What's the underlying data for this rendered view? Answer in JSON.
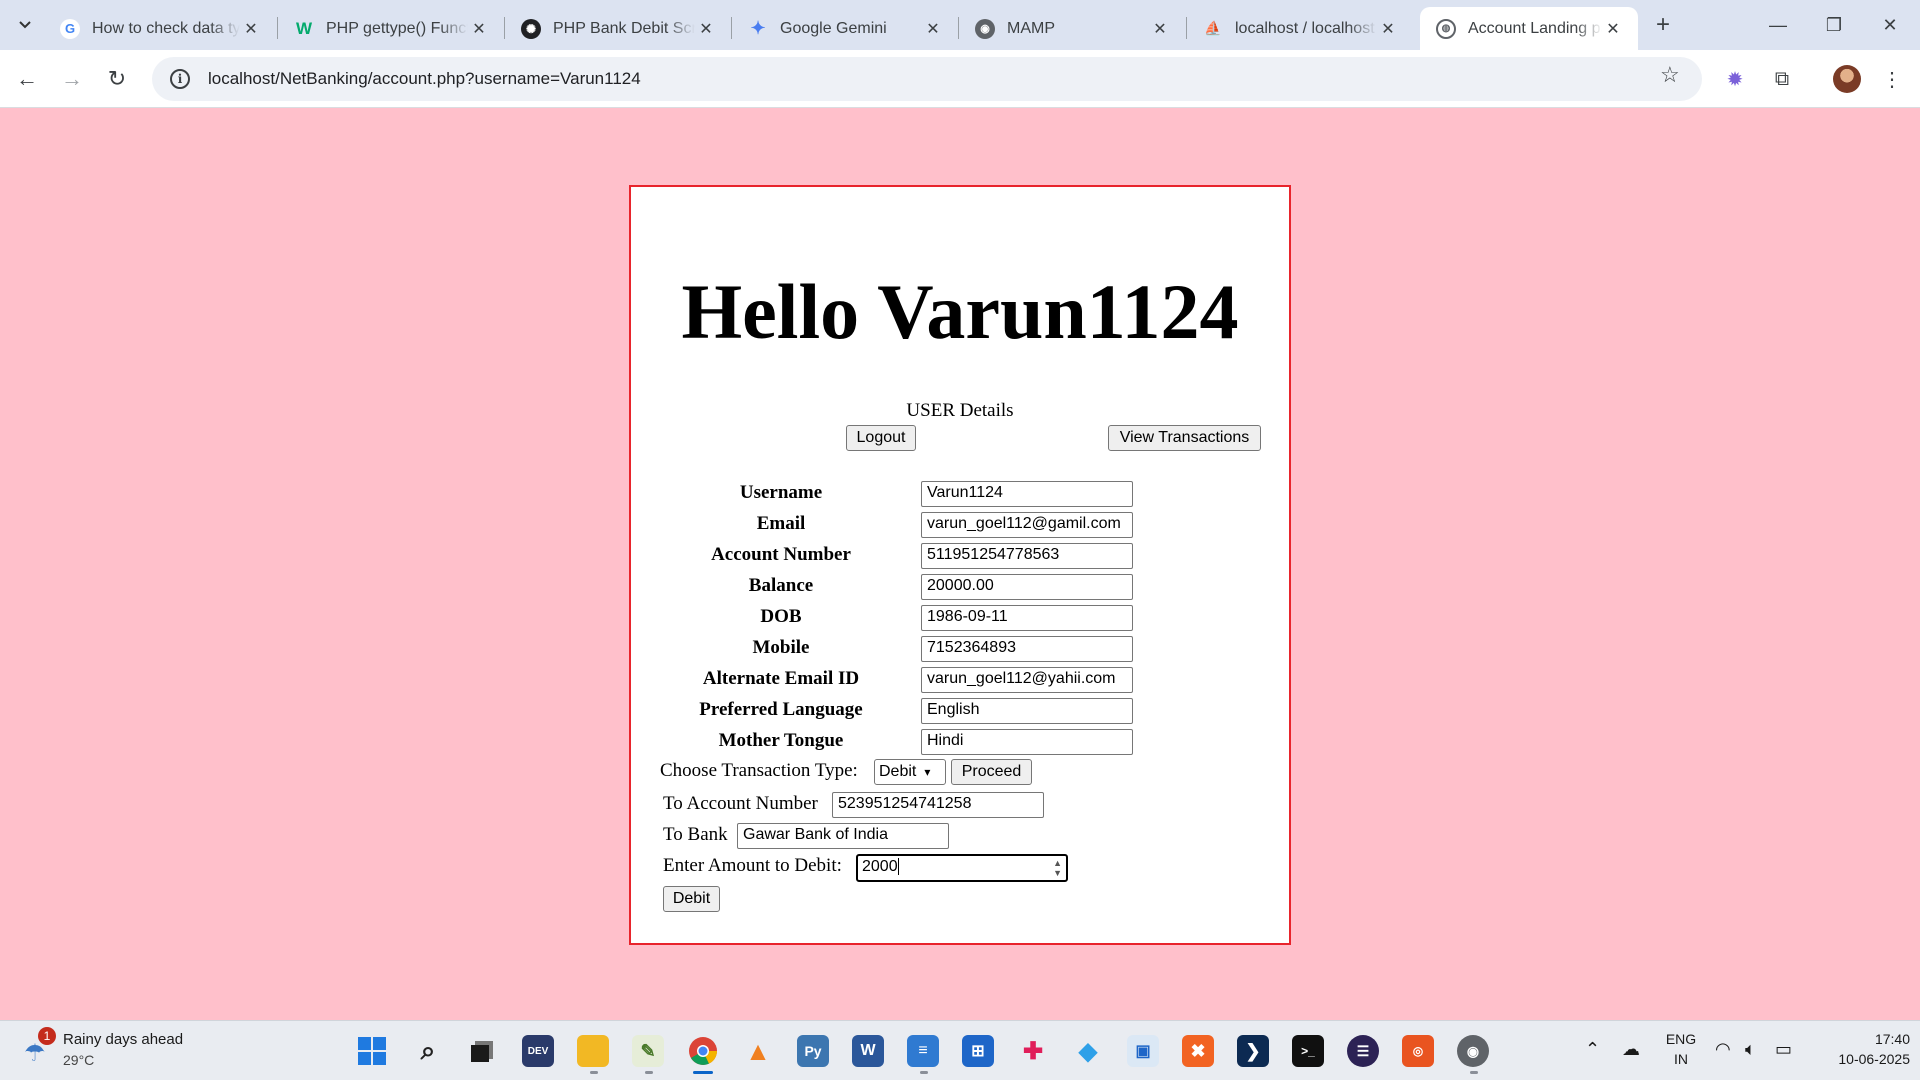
{
  "browser": {
    "tabs": [
      {
        "title": "How to check data ty",
        "favicon": "google-icon"
      },
      {
        "title": "PHP gettype() Functi",
        "favicon": "w3schools-icon"
      },
      {
        "title": "PHP Bank Debit Scrip",
        "favicon": "chatgpt-icon"
      },
      {
        "title": "Google Gemini",
        "favicon": "gemini-icon"
      },
      {
        "title": "MAMP",
        "favicon": "mamp-icon"
      },
      {
        "title": "localhost / localhost",
        "favicon": "phpmyadmin-icon"
      },
      {
        "title": "Account Landing pag",
        "favicon": "globe-icon",
        "active": true
      }
    ],
    "url": "localhost/NetBanking/account.php?username=Varun1124"
  },
  "page": {
    "greeting": "Hello Varun1124",
    "section_title": "USER Details",
    "logout_label": "Logout",
    "view_transactions_label": "View Transactions",
    "details": [
      {
        "label": "Username",
        "value": "Varun1124"
      },
      {
        "label": "Email",
        "value": "varun_goel112@gamil.com"
      },
      {
        "label": "Account Number",
        "value": "511951254778563"
      },
      {
        "label": "Balance",
        "value": "20000.00"
      },
      {
        "label": "DOB",
        "value": "1986-09-11"
      },
      {
        "label": "Mobile",
        "value": "7152364893"
      },
      {
        "label": "Alternate Email ID",
        "value": "varun_goel112@yahii.com"
      },
      {
        "label": "Preferred Language",
        "value": "English"
      },
      {
        "label": "Mother Tongue",
        "value": "Hindi"
      }
    ],
    "transaction": {
      "choose_label": "Choose Transaction Type:",
      "type_selected": "Debit",
      "proceed_label": "Proceed",
      "to_account_label": "To Account Number",
      "to_account_value": "523951254741258",
      "to_bank_label": "To Bank",
      "to_bank_value": "Gawar Bank of India",
      "amount_label": "Enter Amount to Debit:",
      "amount_value": "2000",
      "debit_label": "Debit"
    }
  },
  "taskbar": {
    "weather_title": "Rainy days ahead",
    "weather_temp": "29°C",
    "notification_count": "1",
    "language_line1": "ENG",
    "language_line2": "IN",
    "time": "17:40",
    "date": "10-06-2025"
  },
  "colors": {
    "page_background": "#ffc0cb",
    "panel_border": "#e8242c",
    "tabstrip": "#dce3f1"
  }
}
